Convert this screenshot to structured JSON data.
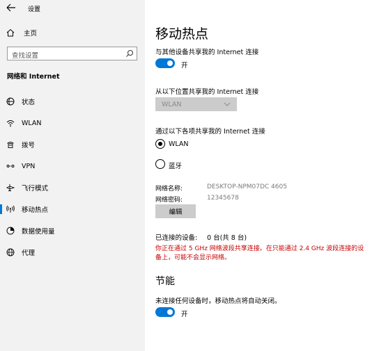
{
  "window": {
    "title": "设置"
  },
  "sidebar": {
    "home_label": "主页",
    "search_placeholder": "查找设置",
    "section_title": "网络和 Internet",
    "items": [
      {
        "label": "状态",
        "icon": "globe-icon"
      },
      {
        "label": "WLAN",
        "icon": "wifi-icon"
      },
      {
        "label": "拨号",
        "icon": "dialup-icon"
      },
      {
        "label": "VPN",
        "icon": "vpn-icon"
      },
      {
        "label": "飞行模式",
        "icon": "airplane-icon"
      },
      {
        "label": "移动热点",
        "icon": "hotspot-icon",
        "active": true
      },
      {
        "label": "数据使用量",
        "icon": "data-usage-icon"
      },
      {
        "label": "代理",
        "icon": "proxy-globe-icon"
      }
    ]
  },
  "main": {
    "title": "移动热点",
    "share_label": "与其他设备共享我的 Internet 连接",
    "share_toggle_text": "开",
    "share_toggle_on": true,
    "from_label": "从以下位置共享我的 Internet 连接",
    "from_value": "WLAN",
    "via_label": "通过以下各项共享我的 Internet 连接",
    "via_options": [
      {
        "label": "WLAN",
        "checked": true
      },
      {
        "label": "蓝牙",
        "checked": false
      }
    ],
    "network_name_key": "网络名称:",
    "network_name_value": "DESKTOP-NPM07DC 4605",
    "network_password_key": "网络密码:",
    "network_password_value": "12345678",
    "edit_button": "编辑",
    "connected_key": "已连接的设备:",
    "connected_value": "0 台(共 8 台)",
    "warning_text": "你正在通过 5 GHz 网络波段共享连接。在只能通过 2.4 GHz 波段连接的设备上，可能不会显示网络。",
    "power_title": "节能",
    "power_desc": "未连接任何设备时，移动热点将自动关闭。",
    "power_toggle_text": "开",
    "power_toggle_on": true
  },
  "colors": {
    "accent": "#0078d7",
    "warning": "#c80000",
    "sidebar_bg": "#f2f2f2"
  }
}
